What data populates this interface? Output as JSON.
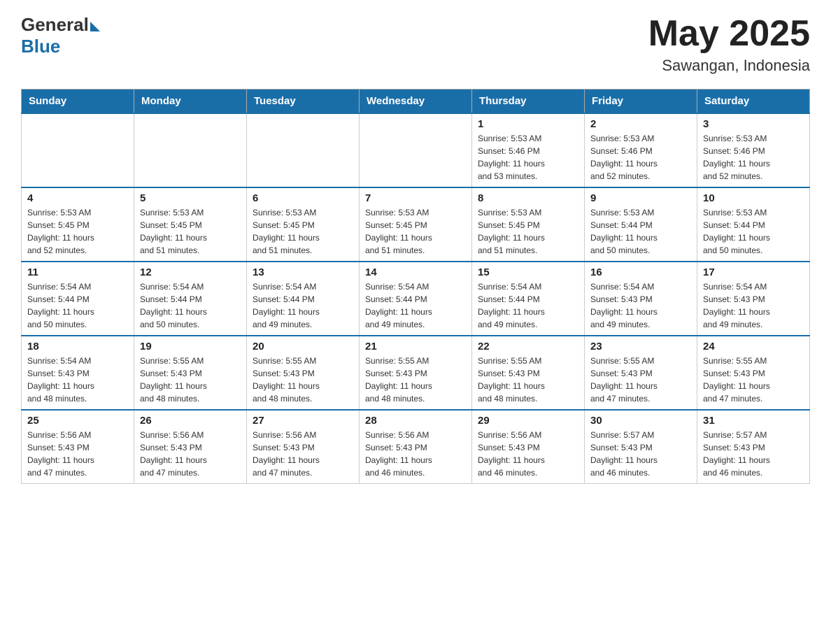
{
  "header": {
    "logo": {
      "general_text": "General",
      "blue_text": "Blue"
    },
    "month_title": "May 2025",
    "location": "Sawangan, Indonesia"
  },
  "calendar": {
    "days_of_week": [
      "Sunday",
      "Monday",
      "Tuesday",
      "Wednesday",
      "Thursday",
      "Friday",
      "Saturday"
    ],
    "weeks": [
      [
        {
          "day": "",
          "info": ""
        },
        {
          "day": "",
          "info": ""
        },
        {
          "day": "",
          "info": ""
        },
        {
          "day": "",
          "info": ""
        },
        {
          "day": "1",
          "info": "Sunrise: 5:53 AM\nSunset: 5:46 PM\nDaylight: 11 hours\nand 53 minutes."
        },
        {
          "day": "2",
          "info": "Sunrise: 5:53 AM\nSunset: 5:46 PM\nDaylight: 11 hours\nand 52 minutes."
        },
        {
          "day": "3",
          "info": "Sunrise: 5:53 AM\nSunset: 5:46 PM\nDaylight: 11 hours\nand 52 minutes."
        }
      ],
      [
        {
          "day": "4",
          "info": "Sunrise: 5:53 AM\nSunset: 5:45 PM\nDaylight: 11 hours\nand 52 minutes."
        },
        {
          "day": "5",
          "info": "Sunrise: 5:53 AM\nSunset: 5:45 PM\nDaylight: 11 hours\nand 51 minutes."
        },
        {
          "day": "6",
          "info": "Sunrise: 5:53 AM\nSunset: 5:45 PM\nDaylight: 11 hours\nand 51 minutes."
        },
        {
          "day": "7",
          "info": "Sunrise: 5:53 AM\nSunset: 5:45 PM\nDaylight: 11 hours\nand 51 minutes."
        },
        {
          "day": "8",
          "info": "Sunrise: 5:53 AM\nSunset: 5:45 PM\nDaylight: 11 hours\nand 51 minutes."
        },
        {
          "day": "9",
          "info": "Sunrise: 5:53 AM\nSunset: 5:44 PM\nDaylight: 11 hours\nand 50 minutes."
        },
        {
          "day": "10",
          "info": "Sunrise: 5:53 AM\nSunset: 5:44 PM\nDaylight: 11 hours\nand 50 minutes."
        }
      ],
      [
        {
          "day": "11",
          "info": "Sunrise: 5:54 AM\nSunset: 5:44 PM\nDaylight: 11 hours\nand 50 minutes."
        },
        {
          "day": "12",
          "info": "Sunrise: 5:54 AM\nSunset: 5:44 PM\nDaylight: 11 hours\nand 50 minutes."
        },
        {
          "day": "13",
          "info": "Sunrise: 5:54 AM\nSunset: 5:44 PM\nDaylight: 11 hours\nand 49 minutes."
        },
        {
          "day": "14",
          "info": "Sunrise: 5:54 AM\nSunset: 5:44 PM\nDaylight: 11 hours\nand 49 minutes."
        },
        {
          "day": "15",
          "info": "Sunrise: 5:54 AM\nSunset: 5:44 PM\nDaylight: 11 hours\nand 49 minutes."
        },
        {
          "day": "16",
          "info": "Sunrise: 5:54 AM\nSunset: 5:43 PM\nDaylight: 11 hours\nand 49 minutes."
        },
        {
          "day": "17",
          "info": "Sunrise: 5:54 AM\nSunset: 5:43 PM\nDaylight: 11 hours\nand 49 minutes."
        }
      ],
      [
        {
          "day": "18",
          "info": "Sunrise: 5:54 AM\nSunset: 5:43 PM\nDaylight: 11 hours\nand 48 minutes."
        },
        {
          "day": "19",
          "info": "Sunrise: 5:55 AM\nSunset: 5:43 PM\nDaylight: 11 hours\nand 48 minutes."
        },
        {
          "day": "20",
          "info": "Sunrise: 5:55 AM\nSunset: 5:43 PM\nDaylight: 11 hours\nand 48 minutes."
        },
        {
          "day": "21",
          "info": "Sunrise: 5:55 AM\nSunset: 5:43 PM\nDaylight: 11 hours\nand 48 minutes."
        },
        {
          "day": "22",
          "info": "Sunrise: 5:55 AM\nSunset: 5:43 PM\nDaylight: 11 hours\nand 48 minutes."
        },
        {
          "day": "23",
          "info": "Sunrise: 5:55 AM\nSunset: 5:43 PM\nDaylight: 11 hours\nand 47 minutes."
        },
        {
          "day": "24",
          "info": "Sunrise: 5:55 AM\nSunset: 5:43 PM\nDaylight: 11 hours\nand 47 minutes."
        }
      ],
      [
        {
          "day": "25",
          "info": "Sunrise: 5:56 AM\nSunset: 5:43 PM\nDaylight: 11 hours\nand 47 minutes."
        },
        {
          "day": "26",
          "info": "Sunrise: 5:56 AM\nSunset: 5:43 PM\nDaylight: 11 hours\nand 47 minutes."
        },
        {
          "day": "27",
          "info": "Sunrise: 5:56 AM\nSunset: 5:43 PM\nDaylight: 11 hours\nand 47 minutes."
        },
        {
          "day": "28",
          "info": "Sunrise: 5:56 AM\nSunset: 5:43 PM\nDaylight: 11 hours\nand 46 minutes."
        },
        {
          "day": "29",
          "info": "Sunrise: 5:56 AM\nSunset: 5:43 PM\nDaylight: 11 hours\nand 46 minutes."
        },
        {
          "day": "30",
          "info": "Sunrise: 5:57 AM\nSunset: 5:43 PM\nDaylight: 11 hours\nand 46 minutes."
        },
        {
          "day": "31",
          "info": "Sunrise: 5:57 AM\nSunset: 5:43 PM\nDaylight: 11 hours\nand 46 minutes."
        }
      ]
    ]
  }
}
